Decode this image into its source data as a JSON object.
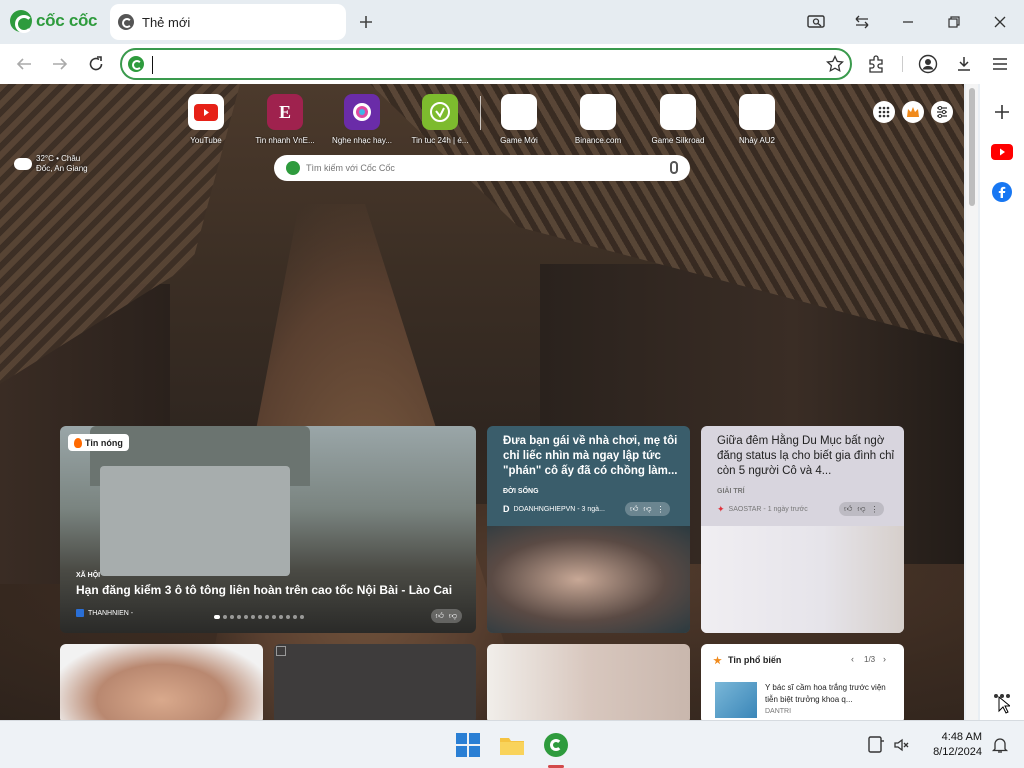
{
  "browser": {
    "brand": "cốc cốc",
    "tab_title": "Thẻ mới",
    "address_value": "",
    "address_placeholder": ""
  },
  "shortcuts": [
    {
      "label": "YouTube",
      "icon": "youtube-icon",
      "color": "#e62117"
    },
    {
      "label": "Tin nhanh VnE...",
      "icon": "vnexpress-icon",
      "color": "#9f224e"
    },
    {
      "label": "Nghe nhạc hay...",
      "icon": "music-icon",
      "color": "#6a2ca8"
    },
    {
      "label": "Tin tuc 24h | é...",
      "icon": "news24h-icon",
      "color": "#7dbb2e"
    },
    {
      "label": "Game Mới",
      "icon": "game-icon",
      "color": "#ffffff"
    },
    {
      "label": "Binance.com",
      "icon": "binance-icon",
      "color": "#ffffff"
    },
    {
      "label": "Game Silkroad",
      "icon": "silkroad-icon",
      "color": "#ffffff"
    },
    {
      "label": "Nhảy AU2",
      "icon": "au2-icon",
      "color": "#ffffff"
    }
  ],
  "weather": {
    "temp": "32°C • Châu",
    "place": "Đốc, An Giang"
  },
  "search": {
    "placeholder": "Tìm kiếm với Cốc Cốc"
  },
  "cards": {
    "hot": {
      "badge": "Tin nóng",
      "category": "XÃ HỘI",
      "title": "Hạn đăng kiểm 3 ô tô tông liên hoàn trên cao tốc Nội Bài - Lào Cai",
      "source": "THANHNIEN -"
    },
    "card2": {
      "title": "Đưa bạn gái về nhà chơi, mẹ tôi chỉ liếc nhìn mà ngay lập tức \"phán\" cô ấy đã có chồng làm...",
      "category": "ĐỜI SỐNG",
      "source": "DOANHNGHIEPVN - 3 ngà..."
    },
    "card3": {
      "title": "Giữa đêm Hằng Du Mục bất ngờ đăng status lạ cho biết gia đình chỉ còn 5 người Cô và 4...",
      "category": "GIẢI TRÍ",
      "source": "SAOSTAR - 1 ngày trước"
    },
    "trending": {
      "label": "Tin phổ biến",
      "page": "1/3",
      "item_title": "Y bác sĩ cầm hoa trắng trước viện tiễn biệt trưởng khoa q...",
      "item_source": "DANTRI"
    }
  },
  "taskbar": {
    "time": "4:48 AM",
    "date": "8/12/2024"
  },
  "colors": {
    "accent": "#2e9b3d",
    "address_border": "#3a9a4d",
    "youtube": "#ff0000",
    "facebook": "#1877f2"
  }
}
